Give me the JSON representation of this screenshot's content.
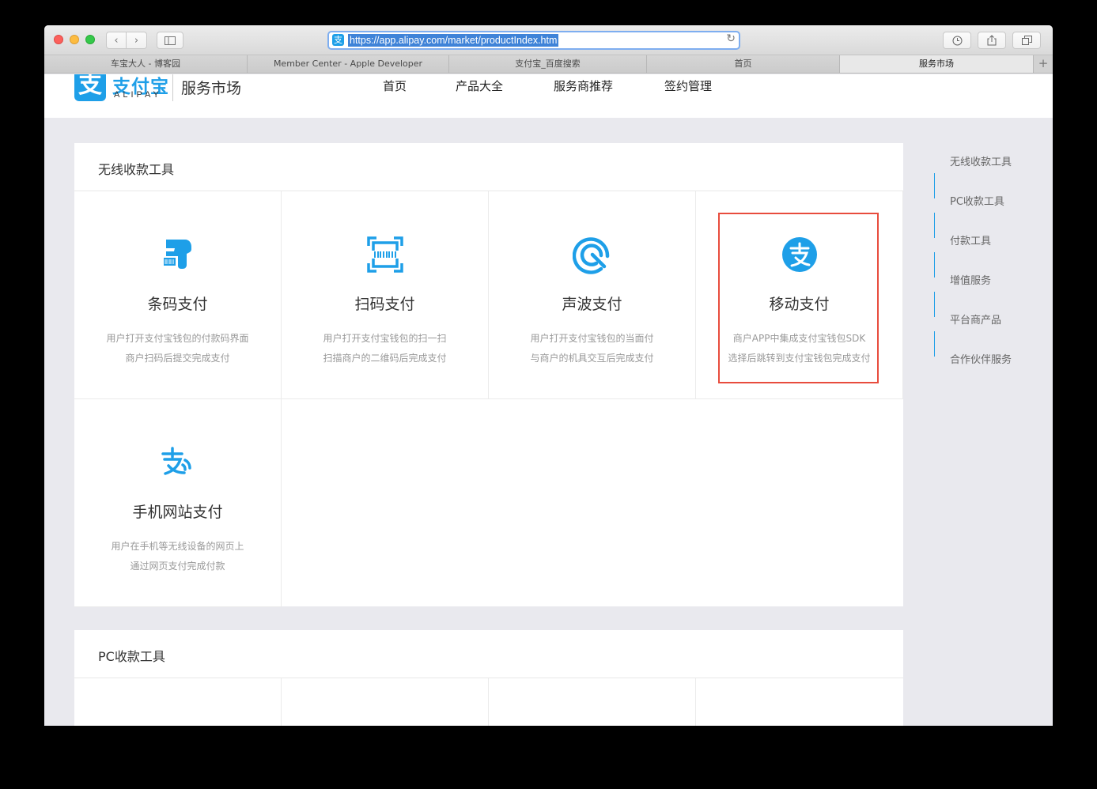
{
  "browser": {
    "url": "https://app.alipay.com/market/productIndex.htm",
    "tabs": [
      {
        "label": "车宝大人 - 博客园",
        "active": false
      },
      {
        "label": "Member Center - Apple Developer",
        "active": false
      },
      {
        "label": "支付宝_百度搜索",
        "active": false
      },
      {
        "label": "首页",
        "active": false
      },
      {
        "label": "服务市场",
        "active": true
      }
    ],
    "new_tab": "+"
  },
  "header": {
    "logo_cn": "支付宝",
    "logo_en": "ALIPAY",
    "logo_mark": "支",
    "service_title": "服务市场",
    "nav": [
      "首页",
      "产品大全",
      "服务商推荐",
      "签约管理"
    ]
  },
  "sections": [
    {
      "title": "无线收款工具",
      "products": [
        {
          "icon": "barcode-scanner-icon",
          "name": "条码支付",
          "desc1": "用户打开支付宝钱包的付款码界面",
          "desc2": "商户扫码后提交完成支付"
        },
        {
          "icon": "qr-scan-icon",
          "name": "扫码支付",
          "desc1": "用户打开支付宝钱包的扫一扫",
          "desc2": "扫描商户的二维码后完成支付"
        },
        {
          "icon": "sound-wave-icon",
          "name": "声波支付",
          "desc1": "用户打开支付宝钱包的当面付",
          "desc2": "与商户的机具交互后完成支付"
        },
        {
          "icon": "alipay-circle-icon",
          "name": "移动支付",
          "desc1": "商户APP中集成支付宝钱包SDK",
          "desc2": "选择后跳转到支付宝钱包完成支付"
        },
        {
          "icon": "alipay-wap-icon",
          "name": "手机网站支付",
          "desc1": "用户在手机等无线设备的网页上",
          "desc2": "通过网页支付完成付款"
        }
      ]
    },
    {
      "title": "PC收款工具"
    }
  ],
  "sidenav": [
    "无线收款工具",
    "PC收款工具",
    "付款工具",
    "增值服务",
    "平台商产品",
    "合作伙伴服务"
  ],
  "colors": {
    "accent": "#1e9fe8",
    "highlight": "#e84c3d"
  }
}
